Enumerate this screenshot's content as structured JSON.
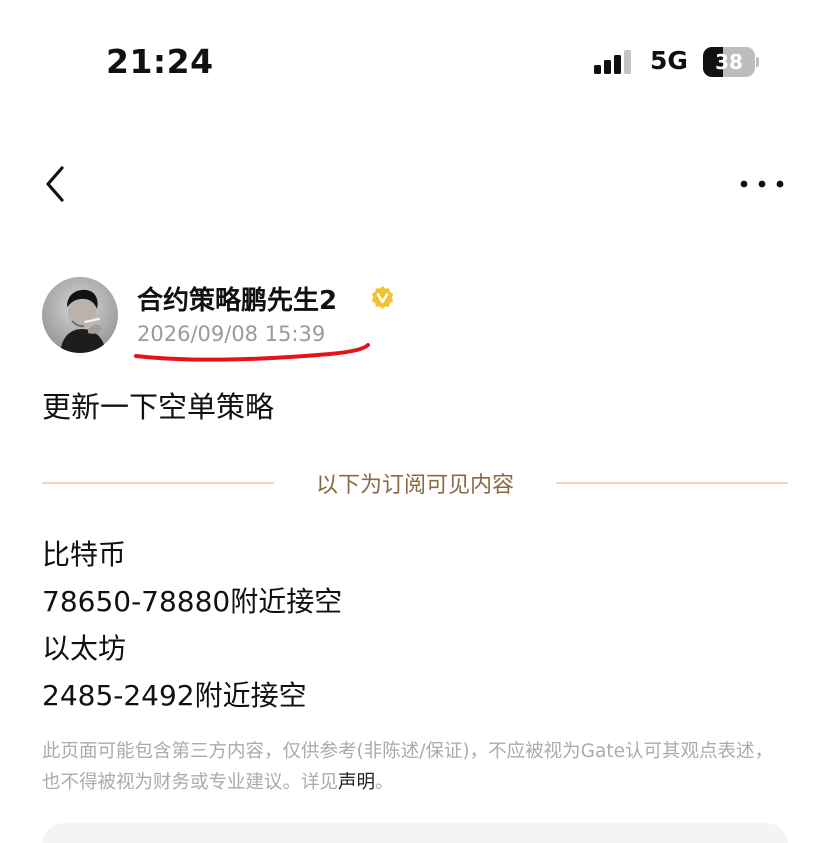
{
  "status_bar": {
    "time": "21:24",
    "network": "5G",
    "battery_level": 38,
    "battery_text": "38"
  },
  "nav": {
    "back_icon": "chevron-left-icon",
    "more_icon": "more-horizontal-icon"
  },
  "post": {
    "author_name": "合约策略鹏先生2",
    "verified_icon": "verified-badge-icon",
    "timestamp": "2026/09/08 15:39",
    "title": "更新一下空单策略",
    "subscription_divider": "以下为订阅可见内容",
    "content_lines": [
      "比特币",
      "78650-78880附近接空",
      "以太坊",
      "2485-2492附近接空"
    ],
    "disclaimer_text": "此页面可能包含第三方内容，仅供参考(非陈述/保证)，不应被视为Gate认可其观点表述，也不得被视为财务或专业建议。详见",
    "disclaimer_link": "声明",
    "disclaimer_end": "。"
  },
  "colors": {
    "accent_gold": "#8a6a45",
    "verified_badge": "#f2c230",
    "annotation_red": "#e5141b",
    "muted_text": "#9a9a9a"
  }
}
